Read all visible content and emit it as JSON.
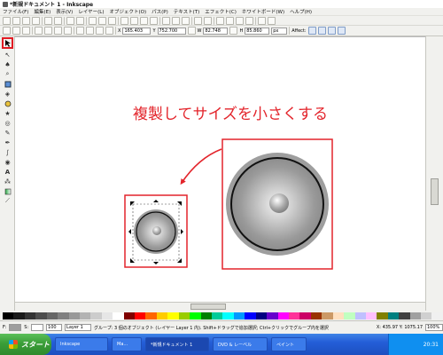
{
  "window": {
    "title": "*新規ドキュメント 1 - Inkscape"
  },
  "menu": [
    {
      "label": "ファイル(F)"
    },
    {
      "label": "編集(E)"
    },
    {
      "label": "表示(V)"
    },
    {
      "label": "レイヤー(L)"
    },
    {
      "label": "オブジェクト(O)"
    },
    {
      "label": "パス(P)"
    },
    {
      "label": "テキスト(T)"
    },
    {
      "label": "エフェクト(C)"
    },
    {
      "label": "ホワイトボード(W)"
    },
    {
      "label": "ヘルプ(H)"
    }
  ],
  "tool_controls": {
    "x_label": "X",
    "x_value": "165.403",
    "y_label": "Y",
    "y_value": "752.700",
    "w_label": "W",
    "w_value": "82.748",
    "h_label": "H",
    "h_value": "85.860",
    "unit": "px",
    "affect_label": "Affect:"
  },
  "canvas": {
    "instruction_text": "複製してサイズを小さくする",
    "accent_color": "#e3242b"
  },
  "palette": {
    "colors": [
      "#000000",
      "#1a1a1a",
      "#333333",
      "#4d4d4d",
      "#666666",
      "#808080",
      "#999999",
      "#b3b3b3",
      "#cccccc",
      "#e6e6e6",
      "#ffffff",
      "#800000",
      "#ff0000",
      "#ff6600",
      "#ffcc00",
      "#ffff00",
      "#99cc00",
      "#00ff00",
      "#008000",
      "#00cc99",
      "#00ffff",
      "#0099ff",
      "#0000ff",
      "#000080",
      "#6600cc",
      "#ff00ff",
      "#ff3399",
      "#cc0066",
      "#993300",
      "#cc9966",
      "#ffe0c0",
      "#c0ffc0",
      "#c0c0ff",
      "#ffc0ff",
      "#808000",
      "#008080",
      "#404040",
      "#a0a0a0",
      "#d0d0d0",
      "#f0f0f0"
    ]
  },
  "statusbar": {
    "fill_label": "F:",
    "stroke_label": "S:",
    "opacity_value": "100",
    "layer_value": "Layer 1",
    "message": "グループ: 3 個のオブジェクト (レイヤー Layer 1 内). Shift+ドラッグで追加選択; Ctrl+クリックでグループ内を選択",
    "coords": "X: 435.97  Y: 1075.17",
    "zoom": "100%"
  },
  "taskbar": {
    "start_label": "スタート",
    "tasks": [
      {
        "label": "Inkscape"
      },
      {
        "label": "Ma..."
      },
      {
        "label": "*新規ドキュメント 1"
      },
      {
        "label": "DVD & レーベル"
      },
      {
        "label": "ペイント"
      }
    ],
    "clock": "20:31"
  }
}
